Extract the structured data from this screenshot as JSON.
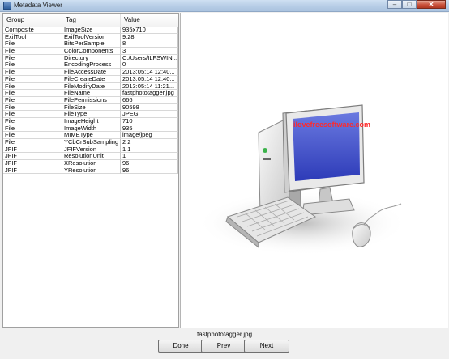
{
  "window": {
    "title": "Metadata Viewer",
    "controls": {
      "minimize": "–",
      "maximize": "□",
      "close": "✕"
    }
  },
  "table": {
    "headers": {
      "group": "Group",
      "tag": "Tag",
      "value": "Value"
    },
    "rows": [
      [
        "Composite",
        "ImageSize",
        "935x710"
      ],
      [
        "ExifTool",
        "ExifToolVersion",
        "9.28"
      ],
      [
        "File",
        "BitsPerSample",
        "8"
      ],
      [
        "File",
        "ColorComponents",
        "3"
      ],
      [
        "File",
        "Directory",
        "C:/Users/ILFSWIN..."
      ],
      [
        "File",
        "EncodingProcess",
        "0"
      ],
      [
        "File",
        "FileAccessDate",
        "2013:05:14 12:40..."
      ],
      [
        "File",
        "FileCreateDate",
        "2013:05:14 12:40..."
      ],
      [
        "File",
        "FileModifyDate",
        "2013:05:14 11:21..."
      ],
      [
        "File",
        "FileName",
        "fastphototagger.jpg"
      ],
      [
        "File",
        "FilePermissions",
        "666"
      ],
      [
        "File",
        "FileSize",
        "90598"
      ],
      [
        "File",
        "FileType",
        "JPEG"
      ],
      [
        "File",
        "ImageHeight",
        "710"
      ],
      [
        "File",
        "ImageWidth",
        "935"
      ],
      [
        "File",
        "MIMEType",
        "image/jpeg"
      ],
      [
        "File",
        "YCbCrSubSampling",
        "2 2"
      ],
      [
        "JFIF",
        "JFIFVersion",
        "1 1"
      ],
      [
        "JFIF",
        "ResolutionUnit",
        "1"
      ],
      [
        "JFIF",
        "XResolution",
        "96"
      ],
      [
        "JFIF",
        "YResolution",
        "96"
      ]
    ]
  },
  "preview": {
    "screen_text": "ilovefreesoftware.com",
    "filename": "fastphototagger.jpg"
  },
  "buttons": {
    "done": "Done",
    "prev": "Prev",
    "next": "Next"
  },
  "colors": {
    "screen": "#3e4fd0",
    "screen_text": "#ff2a2a",
    "close_button": "#c9503a"
  }
}
